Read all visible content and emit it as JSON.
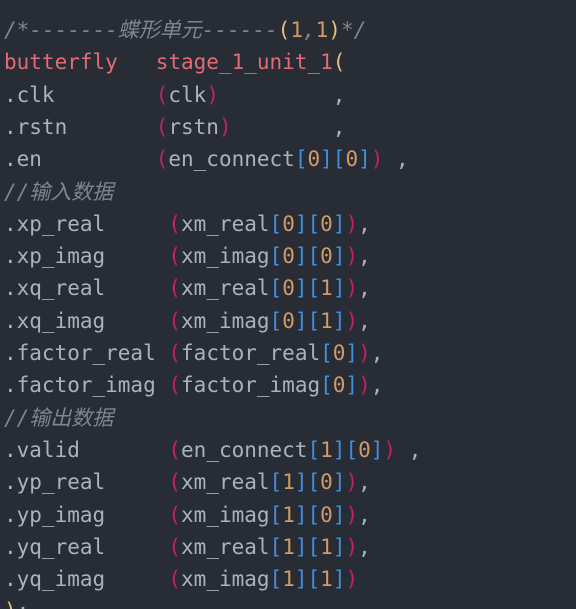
{
  "editor": {
    "background": "#282c34",
    "colors": {
      "comment": "#7f848e",
      "text": "#abb2bf",
      "keyword": "#e06c75",
      "paren": "#c51f6b",
      "paren_gold": "#e5c07b",
      "bracket_blue": "#3f8ee0",
      "number": "#d19a66",
      "bracket_outer": "#c678dd"
    },
    "lines": [
      {
        "text": "/*-------蝶形单元------(1,1)*/",
        "tokens": [
          {
            "t": "/*-------蝶形单元------",
            "c": "comment"
          },
          {
            "t": "(",
            "c": "paren_gold"
          },
          {
            "t": "1",
            "c": "number"
          },
          {
            "t": ",",
            "c": "comment"
          },
          {
            "t": "1",
            "c": "number"
          },
          {
            "t": ")",
            "c": "paren_gold"
          },
          {
            "t": "*/",
            "c": "comment"
          }
        ]
      },
      {
        "text": "butterfly   stage_1_unit_1(",
        "tokens": [
          {
            "t": "butterfly   stage_1_unit_1",
            "c": "keyword"
          },
          {
            "t": "(",
            "c": "paren_gold"
          }
        ]
      },
      {
        "text": ".clk        (clk)         ,",
        "tokens": [
          {
            "t": ".clk        ",
            "c": "text"
          },
          {
            "t": "(",
            "c": "paren"
          },
          {
            "t": "clk",
            "c": "text"
          },
          {
            "t": ")",
            "c": "paren"
          },
          {
            "t": "         ,",
            "c": "text"
          }
        ]
      },
      {
        "text": ".rstn       (rstn)        ,",
        "tokens": [
          {
            "t": ".rstn       ",
            "c": "text"
          },
          {
            "t": "(",
            "c": "paren"
          },
          {
            "t": "rstn",
            "c": "text"
          },
          {
            "t": ")",
            "c": "paren"
          },
          {
            "t": "        ,",
            "c": "text"
          }
        ]
      },
      {
        "text": ".en         (en_connect[0][0]) ,",
        "tokens": [
          {
            "t": ".en         ",
            "c": "text"
          },
          {
            "t": "(",
            "c": "paren"
          },
          {
            "t": "en_connect",
            "c": "text"
          },
          {
            "t": "[",
            "c": "bracket_blue"
          },
          {
            "t": "0",
            "c": "number"
          },
          {
            "t": "]",
            "c": "bracket_blue"
          },
          {
            "t": "[",
            "c": "bracket_blue"
          },
          {
            "t": "0",
            "c": "number"
          },
          {
            "t": "]",
            "c": "bracket_blue"
          },
          {
            "t": ")",
            "c": "paren"
          },
          {
            "t": " ,",
            "c": "text"
          }
        ]
      },
      {
        "text": "//输入数据",
        "tokens": [
          {
            "t": "//输入数据",
            "c": "comment"
          }
        ]
      },
      {
        "text": ".xp_real     (xm_real[0][0]),",
        "tokens": [
          {
            "t": ".xp_real     ",
            "c": "text"
          },
          {
            "t": "(",
            "c": "paren"
          },
          {
            "t": "xm_real",
            "c": "text"
          },
          {
            "t": "[",
            "c": "bracket_blue"
          },
          {
            "t": "0",
            "c": "number"
          },
          {
            "t": "]",
            "c": "bracket_blue"
          },
          {
            "t": "[",
            "c": "bracket_blue"
          },
          {
            "t": "0",
            "c": "number"
          },
          {
            "t": "]",
            "c": "bracket_blue"
          },
          {
            "t": ")",
            "c": "paren"
          },
          {
            "t": ",",
            "c": "text"
          }
        ]
      },
      {
        "text": ".xp_imag     (xm_imag[0][0]),",
        "tokens": [
          {
            "t": ".xp_imag     ",
            "c": "text"
          },
          {
            "t": "(",
            "c": "paren"
          },
          {
            "t": "xm_imag",
            "c": "text"
          },
          {
            "t": "[",
            "c": "bracket_blue"
          },
          {
            "t": "0",
            "c": "number"
          },
          {
            "t": "]",
            "c": "bracket_blue"
          },
          {
            "t": "[",
            "c": "bracket_blue"
          },
          {
            "t": "0",
            "c": "number"
          },
          {
            "t": "]",
            "c": "bracket_blue"
          },
          {
            "t": ")",
            "c": "paren"
          },
          {
            "t": ",",
            "c": "text"
          }
        ]
      },
      {
        "text": ".xq_real     (xm_real[0][1]),",
        "tokens": [
          {
            "t": ".xq_real     ",
            "c": "text"
          },
          {
            "t": "(",
            "c": "paren"
          },
          {
            "t": "xm_real",
            "c": "text"
          },
          {
            "t": "[",
            "c": "bracket_blue"
          },
          {
            "t": "0",
            "c": "number"
          },
          {
            "t": "]",
            "c": "bracket_blue"
          },
          {
            "t": "[",
            "c": "bracket_blue"
          },
          {
            "t": "1",
            "c": "number"
          },
          {
            "t": "]",
            "c": "bracket_blue"
          },
          {
            "t": ")",
            "c": "paren"
          },
          {
            "t": ",",
            "c": "text"
          }
        ]
      },
      {
        "text": ".xq_imag     (xm_imag[0][1]),",
        "tokens": [
          {
            "t": ".xq_imag     ",
            "c": "text"
          },
          {
            "t": "(",
            "c": "paren"
          },
          {
            "t": "xm_imag",
            "c": "text"
          },
          {
            "t": "[",
            "c": "bracket_blue"
          },
          {
            "t": "0",
            "c": "number"
          },
          {
            "t": "]",
            "c": "bracket_blue"
          },
          {
            "t": "[",
            "c": "bracket_blue"
          },
          {
            "t": "1",
            "c": "number"
          },
          {
            "t": "]",
            "c": "bracket_blue"
          },
          {
            "t": ")",
            "c": "paren"
          },
          {
            "t": ",",
            "c": "text"
          }
        ]
      },
      {
        "text": ".factor_real (factor_real[0]),",
        "tokens": [
          {
            "t": ".factor_real ",
            "c": "text"
          },
          {
            "t": "(",
            "c": "paren"
          },
          {
            "t": "factor_real",
            "c": "text"
          },
          {
            "t": "[",
            "c": "bracket_blue"
          },
          {
            "t": "0",
            "c": "number"
          },
          {
            "t": "]",
            "c": "bracket_blue"
          },
          {
            "t": ")",
            "c": "paren"
          },
          {
            "t": ",",
            "c": "text"
          }
        ]
      },
      {
        "text": ".factor_imag (factor_imag[0]),",
        "tokens": [
          {
            "t": ".factor_imag ",
            "c": "text"
          },
          {
            "t": "(",
            "c": "paren"
          },
          {
            "t": "factor_imag",
            "c": "text"
          },
          {
            "t": "[",
            "c": "bracket_blue"
          },
          {
            "t": "0",
            "c": "number"
          },
          {
            "t": "]",
            "c": "bracket_blue"
          },
          {
            "t": ")",
            "c": "paren"
          },
          {
            "t": ",",
            "c": "text"
          }
        ]
      },
      {
        "text": "//输出数据",
        "tokens": [
          {
            "t": "//输出数据",
            "c": "comment"
          }
        ]
      },
      {
        "text": ".valid       (en_connect[1][0]) ,",
        "tokens": [
          {
            "t": ".valid       ",
            "c": "text"
          },
          {
            "t": "(",
            "c": "paren"
          },
          {
            "t": "en_connect",
            "c": "text"
          },
          {
            "t": "[",
            "c": "bracket_blue"
          },
          {
            "t": "1",
            "c": "number"
          },
          {
            "t": "]",
            "c": "bracket_blue"
          },
          {
            "t": "[",
            "c": "bracket_blue"
          },
          {
            "t": "0",
            "c": "number"
          },
          {
            "t": "]",
            "c": "bracket_blue"
          },
          {
            "t": ")",
            "c": "paren"
          },
          {
            "t": " ,",
            "c": "text"
          }
        ]
      },
      {
        "text": ".yp_real     (xm_real[1][0]),",
        "tokens": [
          {
            "t": ".yp_real     ",
            "c": "text"
          },
          {
            "t": "(",
            "c": "paren"
          },
          {
            "t": "xm_real",
            "c": "text"
          },
          {
            "t": "[",
            "c": "bracket_blue"
          },
          {
            "t": "1",
            "c": "number"
          },
          {
            "t": "]",
            "c": "bracket_blue"
          },
          {
            "t": "[",
            "c": "bracket_blue"
          },
          {
            "t": "0",
            "c": "number"
          },
          {
            "t": "]",
            "c": "bracket_blue"
          },
          {
            "t": ")",
            "c": "paren"
          },
          {
            "t": ",",
            "c": "text"
          }
        ]
      },
      {
        "text": ".yp_imag     (xm_imag[1][0]),",
        "tokens": [
          {
            "t": ".yp_imag     ",
            "c": "text"
          },
          {
            "t": "(",
            "c": "paren"
          },
          {
            "t": "xm_imag",
            "c": "text"
          },
          {
            "t": "[",
            "c": "bracket_blue"
          },
          {
            "t": "1",
            "c": "number"
          },
          {
            "t": "]",
            "c": "bracket_blue"
          },
          {
            "t": "[",
            "c": "bracket_blue"
          },
          {
            "t": "0",
            "c": "number"
          },
          {
            "t": "]",
            "c": "bracket_blue"
          },
          {
            "t": ")",
            "c": "paren"
          },
          {
            "t": ",",
            "c": "text"
          }
        ]
      },
      {
        "text": ".yq_real     (xm_real[1][1]),",
        "tokens": [
          {
            "t": ".yq_real     ",
            "c": "text"
          },
          {
            "t": "(",
            "c": "paren"
          },
          {
            "t": "xm_real",
            "c": "text"
          },
          {
            "t": "[",
            "c": "bracket_blue"
          },
          {
            "t": "1",
            "c": "number"
          },
          {
            "t": "]",
            "c": "bracket_blue"
          },
          {
            "t": "[",
            "c": "bracket_blue"
          },
          {
            "t": "1",
            "c": "number"
          },
          {
            "t": "]",
            "c": "bracket_blue"
          },
          {
            "t": ")",
            "c": "paren"
          },
          {
            "t": ",",
            "c": "text"
          }
        ]
      },
      {
        "text": ".yq_imag     (xm_imag[1][1])",
        "tokens": [
          {
            "t": ".yq_imag     ",
            "c": "text"
          },
          {
            "t": "(",
            "c": "paren"
          },
          {
            "t": "xm_imag",
            "c": "text"
          },
          {
            "t": "[",
            "c": "bracket_blue"
          },
          {
            "t": "1",
            "c": "number"
          },
          {
            "t": "]",
            "c": "bracket_blue"
          },
          {
            "t": "[",
            "c": "bracket_blue"
          },
          {
            "t": "1",
            "c": "number"
          },
          {
            "t": "]",
            "c": "bracket_blue"
          },
          {
            "t": ")",
            "c": "paren"
          }
        ]
      },
      {
        "text": ");",
        "tokens": [
          {
            "t": ")",
            "c": "paren_gold"
          },
          {
            "t": ";",
            "c": "text"
          }
        ]
      }
    ]
  }
}
